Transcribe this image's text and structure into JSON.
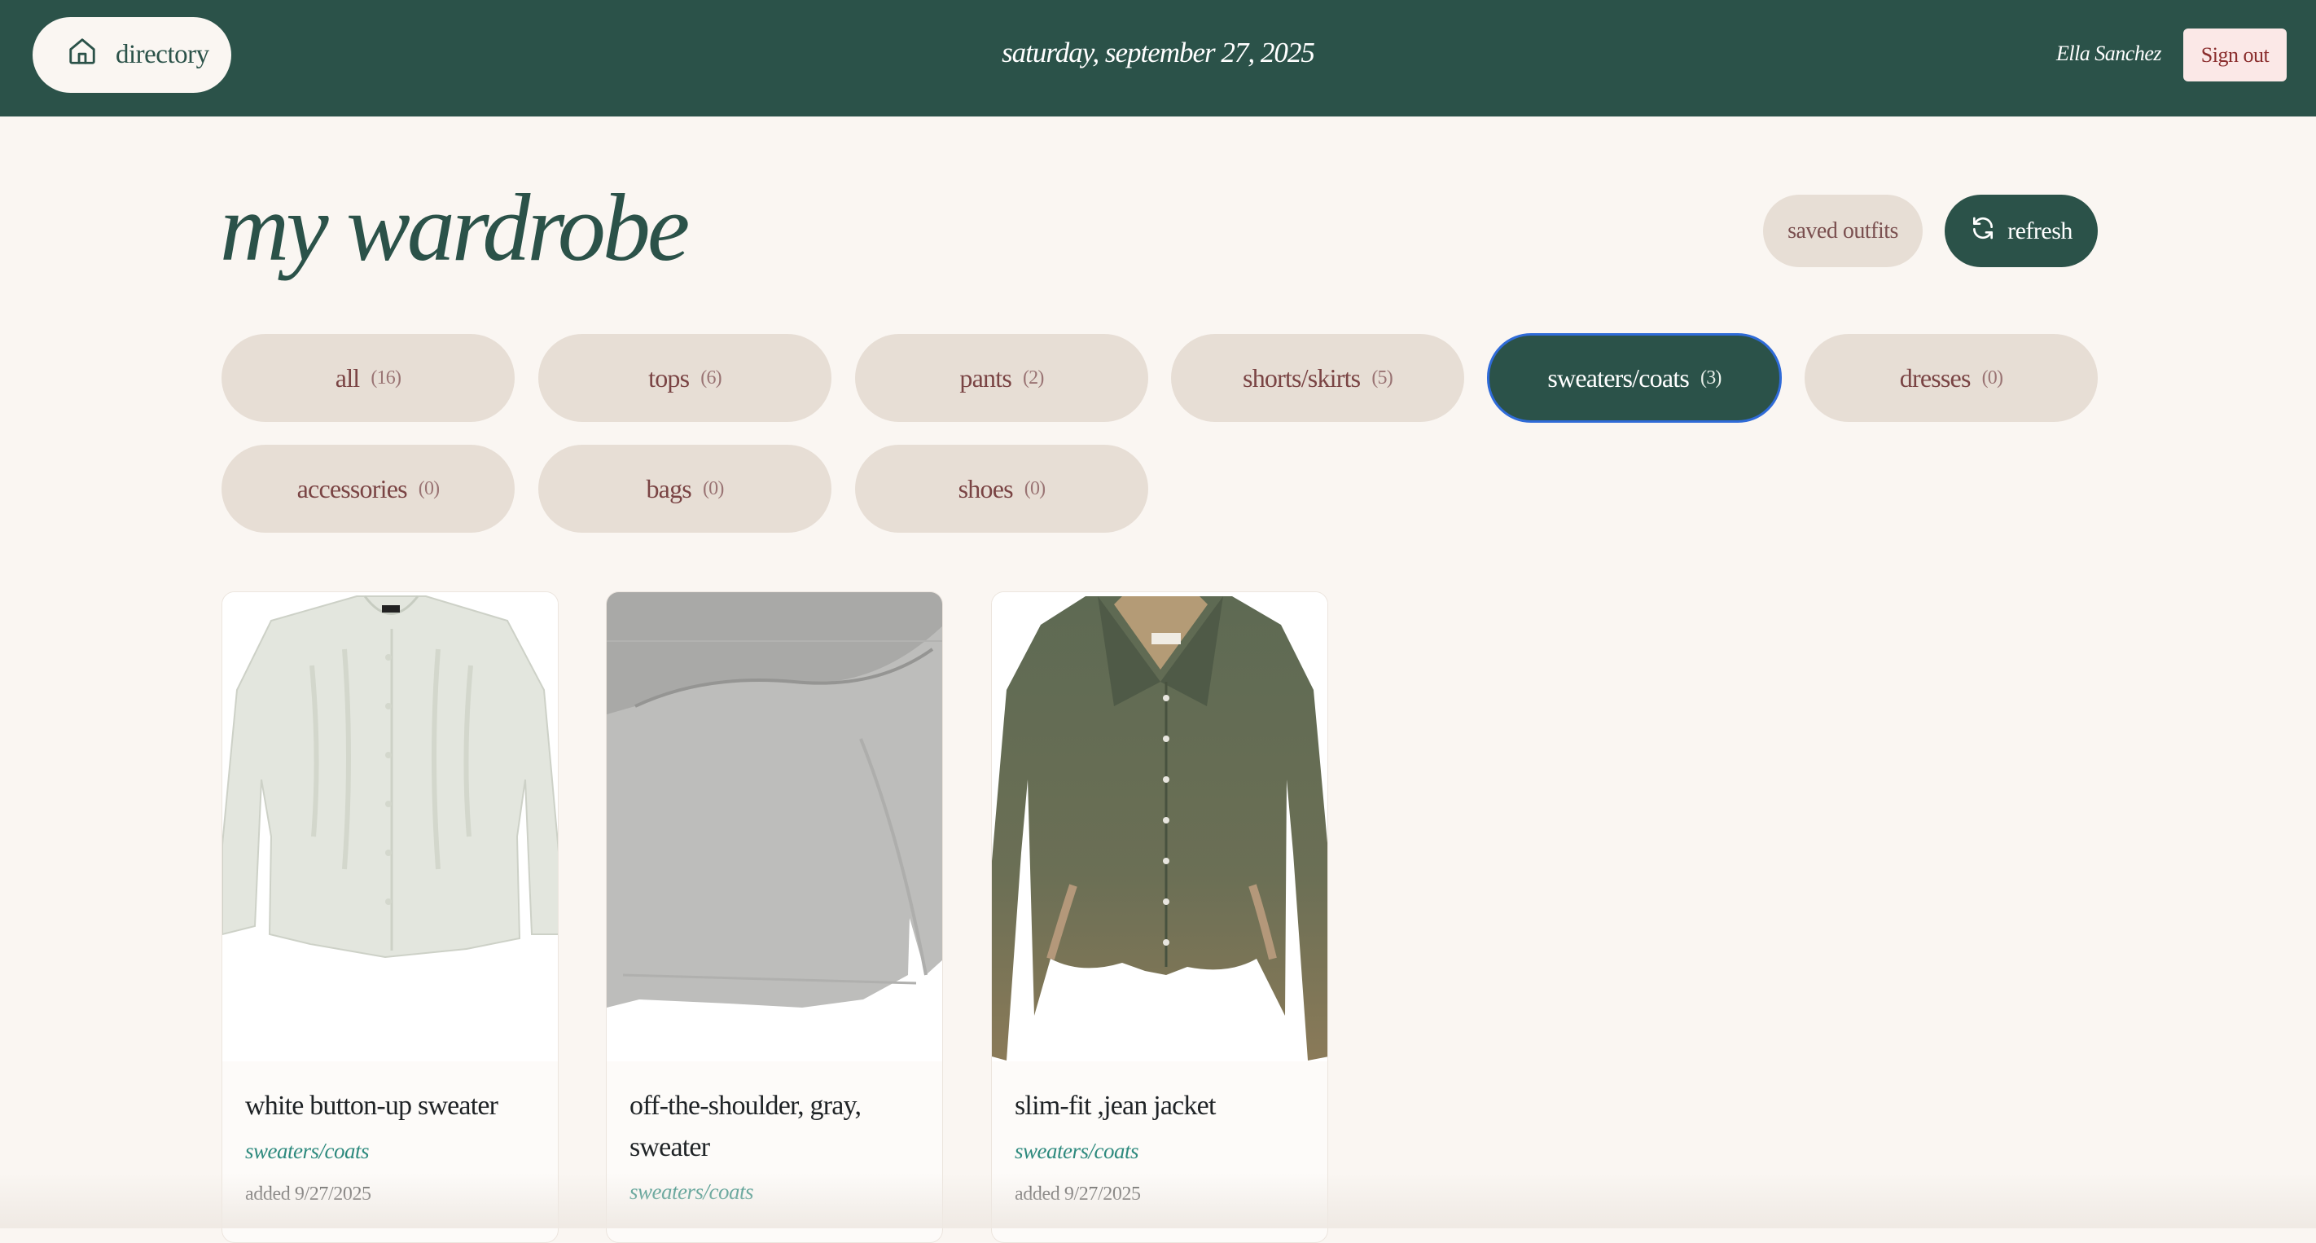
{
  "header": {
    "home_label": "directory",
    "home_icon": "home-icon",
    "date": "saturday, september 27, 2025",
    "user_name": "Ella Sanchez",
    "sign_out": "Sign out"
  },
  "main": {
    "title": "my wardrobe",
    "saved_outfits": "saved outfits",
    "refresh": "refresh",
    "refresh_icon": "refresh-icon"
  },
  "filters": [
    {
      "label": "all",
      "count": "(16)",
      "active": false
    },
    {
      "label": "tops",
      "count": "(6)",
      "active": false
    },
    {
      "label": "pants",
      "count": "(2)",
      "active": false
    },
    {
      "label": "shorts/skirts",
      "count": "(5)",
      "active": false
    },
    {
      "label": "sweaters/coats",
      "count": "(3)",
      "active": true
    },
    {
      "label": "dresses",
      "count": "(0)",
      "active": false
    },
    {
      "label": "accessories",
      "count": "(0)",
      "active": false
    },
    {
      "label": "bags",
      "count": "(0)",
      "active": false
    },
    {
      "label": "shoes",
      "count": "(0)",
      "active": false
    }
  ],
  "items": [
    {
      "name": "white button-up sweater",
      "category": "sweaters/coats",
      "added": "added 9/27/2025"
    },
    {
      "name": "off-the-shoulder, gray, sweater",
      "category": "sweaters/coats",
      "added": ""
    },
    {
      "name": "slim-fit ,jean jacket",
      "category": "sweaters/coats",
      "added": "added 9/27/2025"
    }
  ],
  "colors": {
    "header_bg": "#2b5249",
    "page_bg": "#faf6f2",
    "chip_bg": "#e7ded5",
    "chip_text": "#7a4444",
    "accent_green": "#2b5249",
    "category_text": "#2e8a7e",
    "active_outline": "#2f6bd8"
  }
}
